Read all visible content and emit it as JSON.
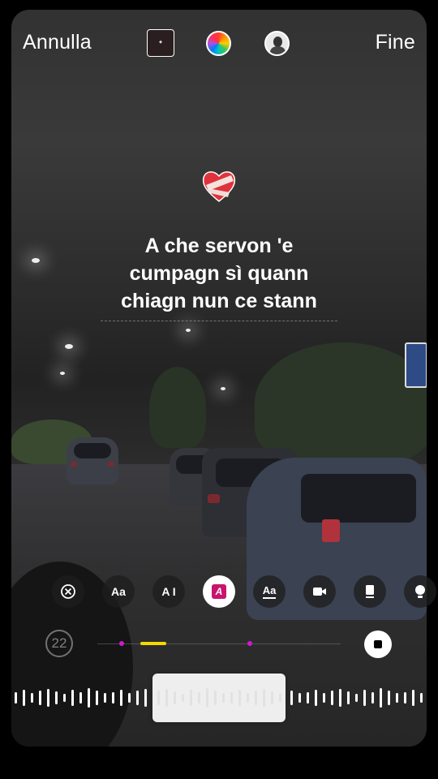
{
  "topbar": {
    "cancel_label": "Annulla",
    "done_label": "Fine"
  },
  "lyrics": {
    "lines": [
      "A che servon 'e",
      "cumpagn sì quann",
      "chiagn nun ce stann"
    ]
  },
  "toolbar": {
    "tools": [
      {
        "name": "remove-icon",
        "label": ""
      },
      {
        "name": "text-style-icon",
        "label": "Aa"
      },
      {
        "name": "text-size-icon",
        "label": "A I"
      },
      {
        "name": "text-highlight-icon",
        "label": "A"
      },
      {
        "name": "text-effect-icon",
        "label": "Aa"
      },
      {
        "name": "camera-icon",
        "label": ""
      },
      {
        "name": "card-icon",
        "label": ""
      },
      {
        "name": "bulb-icon",
        "label": ""
      }
    ]
  },
  "timeline": {
    "duration_label": "22"
  },
  "colors": {
    "accent_yellow": "#f5d800",
    "marker_magenta": "#d01ad0",
    "highlight_pink": "#c8146e"
  }
}
